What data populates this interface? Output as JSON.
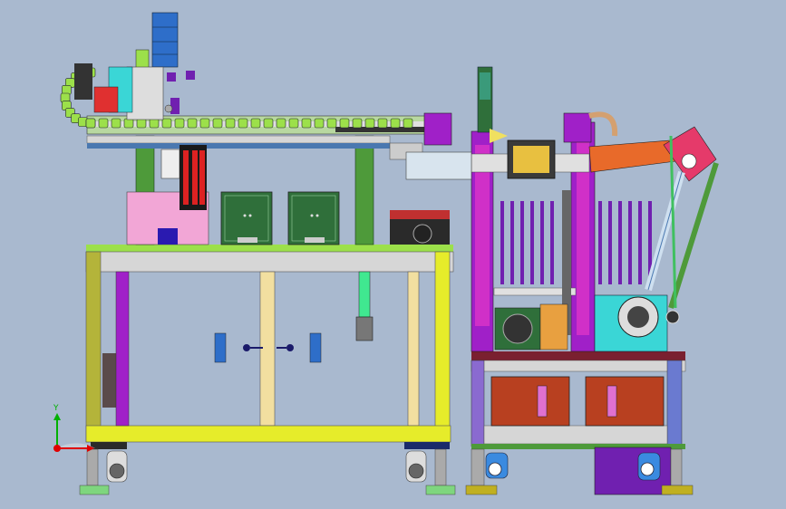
{
  "axes": {
    "y_label": "Y",
    "x_color": "#e00000",
    "y_color": "#00b000",
    "z_color": "#2020e0"
  },
  "colors": {
    "background": "#a9b9cf",
    "frame_yellow": "#e6ec2a",
    "frame_olive": "#b4b43a",
    "frame_beige": "#f2dfa0",
    "green": "#4e9a3a",
    "dark_green": "#2f6f3a",
    "purple": "#a020c8",
    "magenta": "#d030c8",
    "pink": "#f2a6d6",
    "lime": "#9ce04a",
    "blue": "#2e6ec9",
    "steel_blue": "#4a78b0",
    "orange": "#e86a2a",
    "brown_red": "#b84020",
    "dark_red": "#7a2030",
    "gray": "#8a8a8a",
    "light_gray": "#d6d6d6",
    "white": "#f0f0f0",
    "dark": "#1a1a1a",
    "cyan": "#3ad6d6",
    "mint": "#40e890",
    "violet": "#7020b0"
  },
  "parts": [
    "left-frame-table",
    "gantry-frame",
    "cable-drag-chain",
    "linear-guide-rail",
    "control-cabinet-left",
    "control-cabinet-right",
    "pink-control-box",
    "swivel-caster-left",
    "swivel-caster-mid",
    "feeder-tower",
    "signal-light-column",
    "rotary-table",
    "drive-motor",
    "manipulator-arm",
    "lower-cabinet",
    "cabinet-door-left",
    "cabinet-door-right"
  ]
}
